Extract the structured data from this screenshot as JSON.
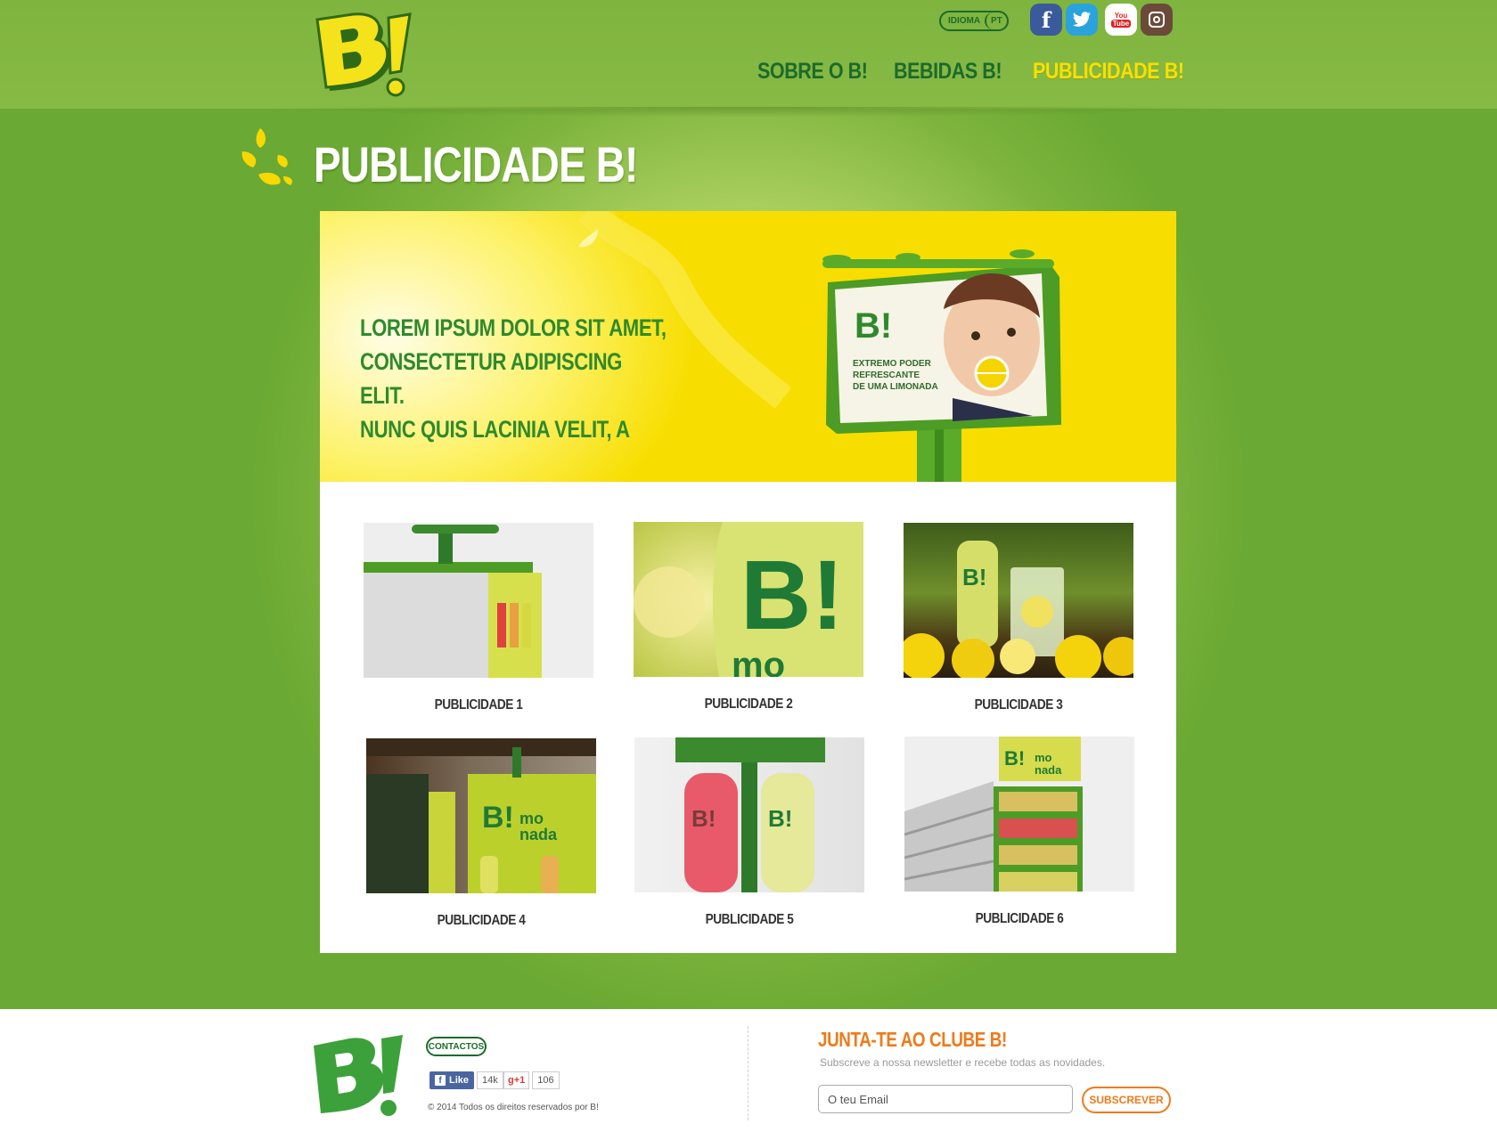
{
  "header": {
    "language": {
      "label": "IDIOMA",
      "value": "PT"
    },
    "social": [
      {
        "name": "facebook-icon",
        "glyph": "f"
      },
      {
        "name": "twitter-icon",
        "glyph": "🐦"
      },
      {
        "name": "youtube-icon",
        "glyph_top": "You",
        "glyph_bottom": "Tube"
      },
      {
        "name": "instagram-icon"
      }
    ],
    "nav": [
      {
        "label": "SOBRE O B!",
        "active": false
      },
      {
        "label": "BEBIDAS B!",
        "active": false
      },
      {
        "label": "PUBLICIDADE B!",
        "active": true
      }
    ]
  },
  "page": {
    "title": "PUBLICIDADE B!"
  },
  "banner": {
    "lines": [
      "LOREM IPSUM DOLOR SIT AMET,",
      "CONSECTETUR ADIPISCING ELIT.",
      "NUNC QUIS LACINIA VELIT, A"
    ],
    "billboard_logo": "B!",
    "billboard_text": [
      "EXTREMO PODER",
      "REFRESCANTE",
      "DE UMA LIMONADA"
    ]
  },
  "gallery": {
    "items": [
      {
        "label": "PUBLICIDADE 1"
      },
      {
        "label": "PUBLICIDADE 2"
      },
      {
        "label": "PUBLICIDADE 3"
      },
      {
        "label": "PUBLICIDADE 4"
      },
      {
        "label": "PUBLICIDADE 5"
      },
      {
        "label": "PUBLICIDADE 6"
      }
    ]
  },
  "footer": {
    "contacts_label": "CONTACTOS",
    "fb_like_label": "Like",
    "fb_like_count": "14k",
    "gplus_label": "+1",
    "gplus_count": "106",
    "copyright": "© 2014 Todos os direitos reservados por B!",
    "club": {
      "title": "JUNTA-TE AO CLUBE B!",
      "subtitle": "Subscreve a nossa newsletter e recebe todas as novidades.",
      "email_placeholder": "O teu Email",
      "subscribe_label": "SUBSCREVER"
    }
  },
  "colors": {
    "brand_green": "#1d6a2c",
    "brand_yellow": "#f9e000",
    "accent_orange": "#f07a1a"
  }
}
